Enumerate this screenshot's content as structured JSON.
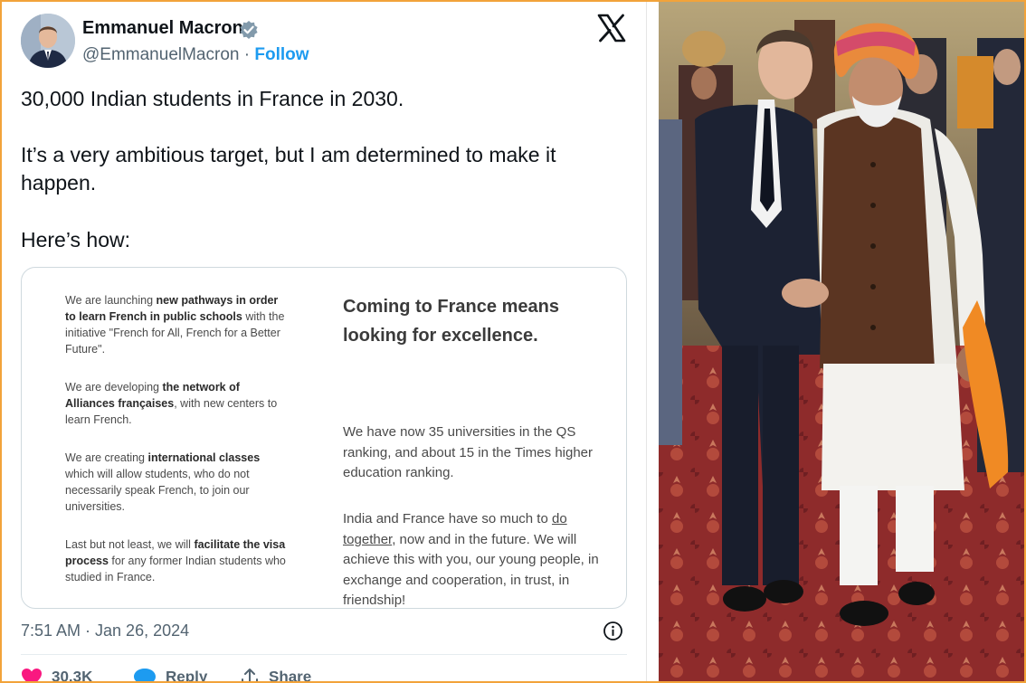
{
  "author": {
    "name": "Emmanuel Macron",
    "handle": "@EmmanuelMacron",
    "separator": "·",
    "follow_label": "Follow"
  },
  "tweet": {
    "line1": "30,000 Indian students in France in 2030.",
    "line2": "It’s a very ambitious target, but I am determined to make it happen.",
    "line3": "Here’s how:"
  },
  "media_card": {
    "left": {
      "p1_a": "We are launching ",
      "p1_b": "new pathways in order to learn French in public schools",
      "p1_c": " with the initiative \"French for All, French for a Better Future\".",
      "p2_a": "We are developing ",
      "p2_b": "the network of Alliances françaises",
      "p2_c": ", with new centers to learn French.",
      "p3_a": "We are creating ",
      "p3_b": "international classes",
      "p3_c": " which will allow students, who do not necessarily speak French, to join our universities.",
      "p4_a": "Last but not least, we will ",
      "p4_b": "facilitate the visa process",
      "p4_c": " for any former Indian students who studied in France."
    },
    "right": {
      "heading": "Coming to France means looking for excellence.",
      "para1": "We have now 35 universities in the QS ranking, and about 15 in the Times higher education ranking.",
      "para2_a": "India and France have so much to ",
      "para2_link": "do together",
      "para2_b": ", now and in the future. We will achieve this with you, our young people, in exchange and cooperation, in trust, in friendship!"
    }
  },
  "timestamp": "7:51 AM · Jan 26, 2024",
  "actions": {
    "likes": "30.3K",
    "reply_label": "Reply",
    "share_label": "Share"
  },
  "icons": {
    "verified": "verified-badge-icon",
    "x_logo": "x-logo-icon",
    "info": "info-icon",
    "like": "heart-icon",
    "reply": "reply-bubble-icon",
    "share": "share-icon"
  },
  "colors": {
    "frame_border": "#f2a33a",
    "follow": "#1d9bf0",
    "like": "#f91880",
    "text": "#0f1419",
    "muted": "#536471"
  }
}
